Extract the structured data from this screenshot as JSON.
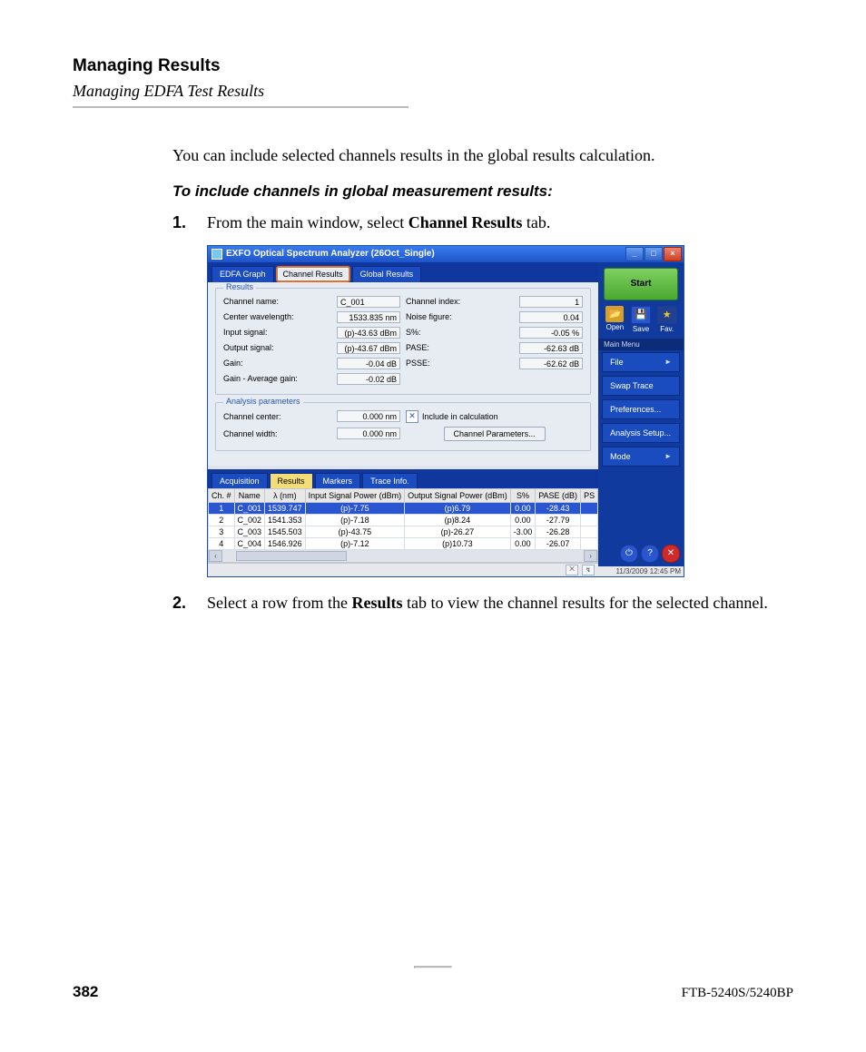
{
  "doc": {
    "heading": "Managing Results",
    "subheading": "Managing EDFA Test Results",
    "intro": "You can include selected channels results in the global results calculation.",
    "procedure_heading": "To include channels in global measurement results:",
    "steps": [
      {
        "num": "1.",
        "pre": "From the main window, select ",
        "bold": "Channel Results",
        "post": " tab."
      },
      {
        "num": "2.",
        "pre": "Select a row from the ",
        "bold": "Results",
        "post": " tab to view the channel results for the selected channel."
      }
    ],
    "page_number": "382",
    "model": "FTB-5240S/5240BP"
  },
  "app": {
    "title": "EXFO Optical Spectrum Analyzer (26Oct_Single)",
    "upper_tabs": [
      "EDFA Graph",
      "Channel Results",
      "Global Results"
    ],
    "results": {
      "legend": "Results",
      "rows": [
        {
          "l_label": "Channel name:",
          "l_value": "C_001",
          "r_label": "Channel index:",
          "r_value": "1"
        },
        {
          "l_label": "Center wavelength:",
          "l_value": "1533.835 nm",
          "r_label": "Noise figure:",
          "r_value": "0.04"
        },
        {
          "l_label": "Input signal:",
          "l_value": "(p)-43.63 dBm",
          "r_label": "S%:",
          "r_value": "-0.05 %"
        },
        {
          "l_label": "Output signal:",
          "l_value": "(p)-43.67 dBm",
          "r_label": "PASE:",
          "r_value": "-62.63 dB"
        },
        {
          "l_label": "Gain:",
          "l_value": "-0.04 dB",
          "r_label": "PSSE:",
          "r_value": "-62.62 dB"
        },
        {
          "l_label": "Gain - Average gain:",
          "l_value": "-0.02 dB"
        }
      ]
    },
    "analysis": {
      "legend": "Analysis parameters",
      "rows": [
        {
          "label": "Channel center:",
          "value": "0.000 nm"
        },
        {
          "label": "Channel width:",
          "value": "0.000 nm"
        }
      ],
      "include_label": "Include in calculation",
      "button": "Channel Parameters..."
    },
    "lower_tabs": [
      "Acquisition",
      "Results",
      "Markers",
      "Trace Info."
    ],
    "table": {
      "headers": [
        "Ch. #",
        "Name",
        "λ (nm)",
        "Input Signal Power (dBm)",
        "Output Signal Power (dBm)",
        "S%",
        "PASE (dB)",
        "PS"
      ],
      "rows": [
        {
          "sel": true,
          "cells": [
            "1",
            "C_001",
            "1539.747",
            "(p)-7.75",
            "(p)6.79",
            "0.00",
            "-28.43",
            ""
          ]
        },
        {
          "sel": false,
          "cells": [
            "2",
            "C_002",
            "1541.353",
            "(p)-7.18",
            "(p)8.24",
            "0.00",
            "-27.79",
            ""
          ]
        },
        {
          "sel": false,
          "cells": [
            "3",
            "C_003",
            "1545.503",
            "(p)-43.75",
            "(p)-26.27",
            "-3.00",
            "-26.28",
            ""
          ]
        },
        {
          "sel": false,
          "cells": [
            "4",
            "C_004",
            "1546.926",
            "(p)-7.12",
            "(p)10.73",
            "0.00",
            "-26.07",
            ""
          ]
        }
      ]
    },
    "side": {
      "start": "Start",
      "icons": [
        "Open",
        "Save",
        "Fav."
      ],
      "menu_header": "Main Menu",
      "menu": [
        "File",
        "Swap Trace",
        "Preferences...",
        "Analysis Setup...",
        "Mode"
      ]
    },
    "timestamp": "11/3/2009 12:45 PM"
  }
}
